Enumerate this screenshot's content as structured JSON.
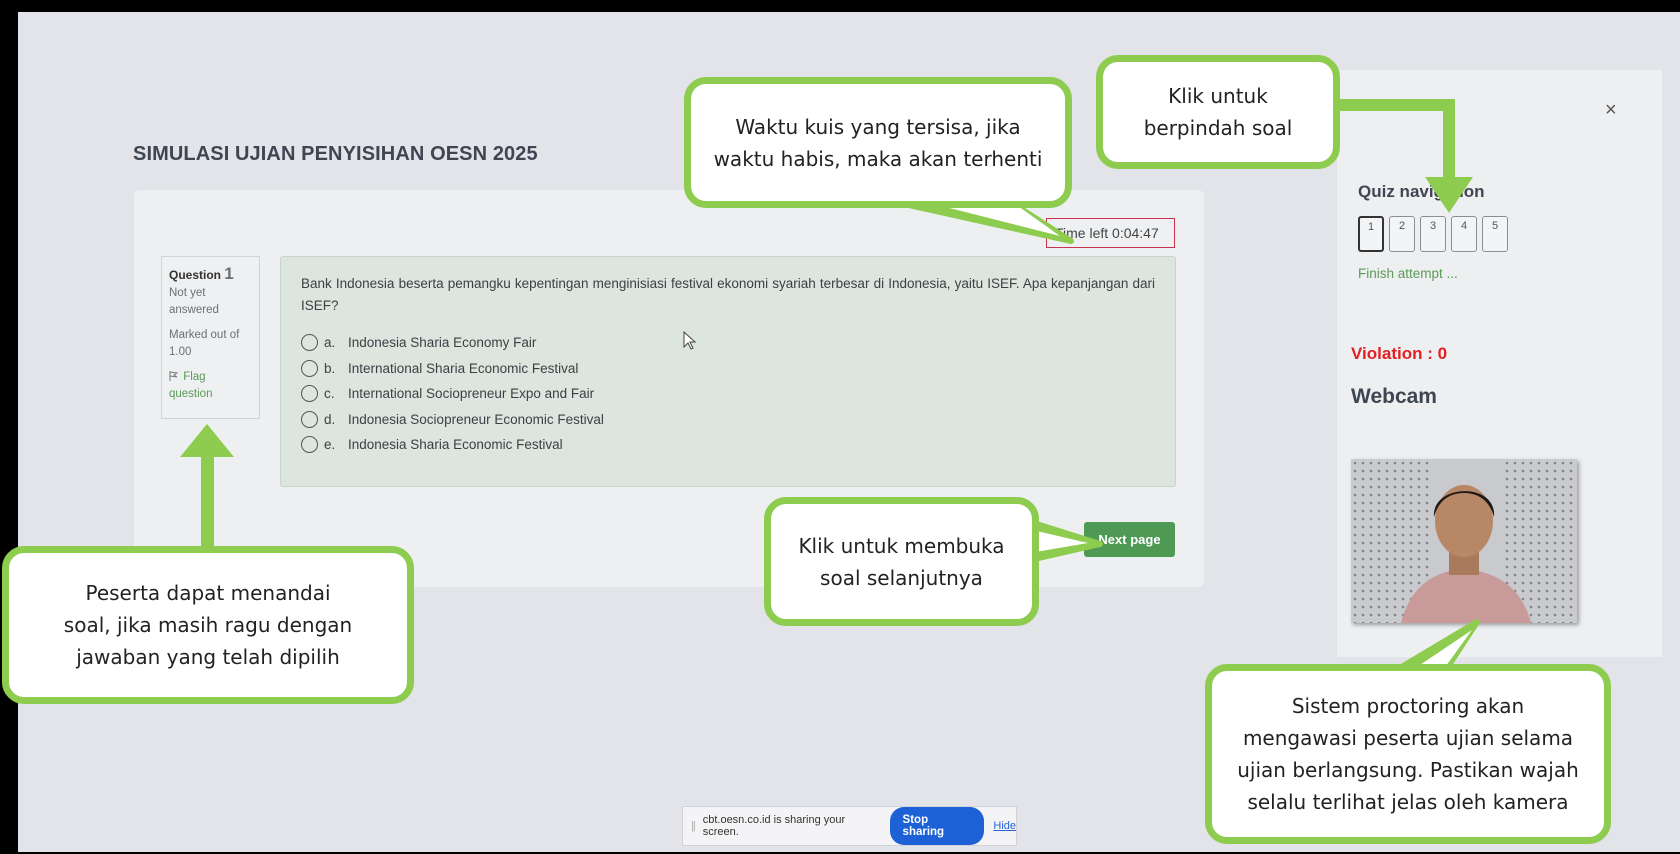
{
  "page_title": "SIMULASI UJIAN PENYISIHAN OESN 2025",
  "timer": {
    "label": "Time left",
    "value": "0:04:47"
  },
  "question_info": {
    "label": "Question",
    "number": "1",
    "status_line1": "Not yet",
    "status_line2": "answered",
    "marked_line1": "Marked out of",
    "marked_line2": "1.00",
    "flag_icon": "flag-icon",
    "flag_line1": "Flag",
    "flag_line2": "question"
  },
  "question": {
    "text": "Bank Indonesia beserta pemangku kepentingan menginisiasi festival ekonomi syariah terbesar di Indonesia, yaitu ISEF. Apa kepanjangan dari ISEF?",
    "answers": [
      {
        "letter": "a.",
        "text": "Indonesia Sharia Economy Fair"
      },
      {
        "letter": "b.",
        "text": "International Sharia Economic Festival"
      },
      {
        "letter": "c.",
        "text": "International Sociopreneur Expo and Fair"
      },
      {
        "letter": "d.",
        "text": "Indonesia Sociopreneur Economic Festival"
      },
      {
        "letter": "e.",
        "text": "Indonesia Sharia Economic Festival"
      }
    ]
  },
  "next_button": "Next page",
  "sidebar": {
    "close_label": "×",
    "nav_title": "Quiz navigation",
    "nav_buttons": [
      "1",
      "2",
      "3",
      "4",
      "5"
    ],
    "current_question": 1,
    "finish_link": "Finish attempt ...",
    "violation": "Violation : 0",
    "webcam_title": "Webcam"
  },
  "share_bar": {
    "message": "cbt.oesn.co.id is sharing your screen.",
    "stop_label": "Stop sharing",
    "hide_label": "Hide"
  },
  "callouts": {
    "timer": [
      "Waktu kuis yang tersisa, jika",
      "waktu habis, maka akan terhenti"
    ],
    "navigation": [
      "Klik untuk",
      "berpindah soal"
    ],
    "flag": [
      "Peserta dapat menandai",
      "soal, jika masih ragu dengan",
      "jawaban yang telah dipilih"
    ],
    "next": [
      "Klik untuk membuka",
      "soal selanjutnya"
    ],
    "webcam": [
      "Sistem proctoring akan",
      "mengawasi peserta ujian selama",
      "ujian berlangsung. Pastikan wajah",
      "selalu terlihat jelas oleh kamera"
    ]
  },
  "colors": {
    "callout_border": "#8dcc4f",
    "timer_border": "#c8334e",
    "next_button": "#4e9a55",
    "violation": "#e22020",
    "stop_sharing": "#1c62d6"
  }
}
